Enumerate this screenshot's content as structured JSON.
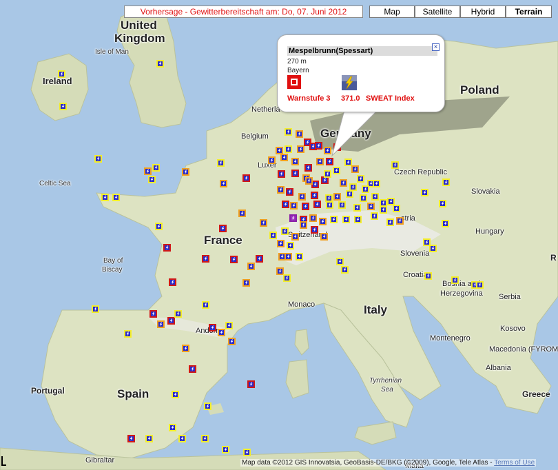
{
  "header": {
    "forecast_label": "Vorhersage - Gewitterbereitschaft am: Do, 07. Juni 2012"
  },
  "map_types": [
    {
      "label": "Map",
      "active": false
    },
    {
      "label": "Satellite",
      "active": false
    },
    {
      "label": "Hybrid",
      "active": false
    },
    {
      "label": "Terrain",
      "active": true
    }
  ],
  "popup": {
    "title": "Mespelbrunn(Spessart)",
    "elevation": "270 m",
    "region": "Bayern",
    "warn_label": "Warnstufe 3",
    "index_value": "371.0",
    "index_label": "SWEAT Index",
    "close_symbol": "×"
  },
  "labels": {
    "united": "United",
    "kingdom": "Kingdom",
    "isle_of_man": "Isle of Man",
    "ireland": "Ireland",
    "netherlands": "Netherla",
    "belgium": "Belgium",
    "luxembourg": "Luxer",
    "germany": "Germany",
    "poland": "Poland",
    "czech": "Czech Republic",
    "slovakia": "Slovakia",
    "hungary": "Hungary",
    "austria": "stria",
    "slovenia": "Slovenia",
    "croatia": "Croatia",
    "bosnia1": "Bosnia and",
    "bosnia2": "Herzegovina",
    "serbia": "Serbia",
    "montenegro": "Montenegro",
    "kosovo": "Kosovo",
    "macedonia": "Macedonia (FYROM",
    "albania": "Albania",
    "greece": "Greece",
    "italy": "Italy",
    "france": "France",
    "switzerland": "Switzerland",
    "monaco": "Monaco",
    "andorra": "Andorra",
    "spain": "Spain",
    "portugal": "Portugal",
    "gibraltar": "Gibraltar",
    "malta": "Malta",
    "celtic_sea": "Celtic Sea",
    "bay_of1": "Bay of",
    "bay_of2": "Biscay",
    "tyrrhenian1": "Tyrrhenian",
    "tyrrhenian2": "Sea",
    "r_edge": "R"
  },
  "attribution": {
    "text": "Map data ©2012 GIS Innovatsia, GeoBasis-DE/BKG (©2009), Google, Tele Atlas - ",
    "terms": "Terms of Use"
  },
  "colors": {
    "sea": "#a8c8e8",
    "land": "#dfe6c6",
    "warn_red": "#e01010",
    "marker_blue": "#2b2bc8"
  }
}
